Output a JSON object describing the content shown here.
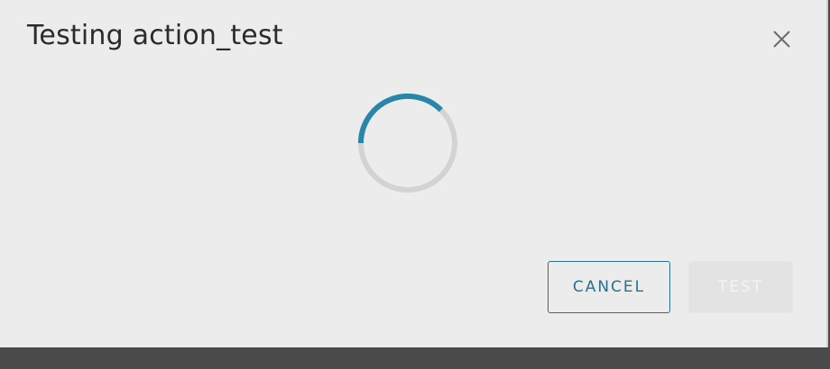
{
  "dialog": {
    "title": "Testing action_test",
    "close_icon": "close-icon",
    "spinner": {
      "icon": "loading-spinner-icon",
      "accent_color": "#2a86a8",
      "track_color": "#d3d3d3"
    },
    "buttons": {
      "cancel_label": "CANCEL",
      "test_label": "TEST"
    }
  },
  "colors": {
    "dialog_background": "#ececec",
    "outline_button": "#2d6f8a",
    "overlay": "#4a4a4a"
  }
}
